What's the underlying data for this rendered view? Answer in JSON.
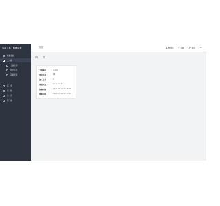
{
  "sidebar": {
    "title": "弓箭工具 · 管理后台",
    "items": [
      {
        "label": "数据看板"
      },
      {
        "label": "土 · 用"
      },
      {
        "label": "土壤检测"
      },
      {
        "label": "用户信息"
      },
      {
        "label": "设备管理"
      },
      {
        "label": "任 · 务"
      },
      {
        "label": "系 · 统"
      },
      {
        "label": "日 · 志"
      },
      {
        "label": "帮 · 助"
      }
    ]
  },
  "topbar": {
    "breadcrumb": "首页",
    "actions": [
      {
        "label": "管理员",
        "icon": "user-icon"
      },
      {
        "label": "切换",
        "icon": "switch-icon"
      },
      {
        "label": "退出",
        "icon": "logout-icon"
      }
    ]
  },
  "detail": {
    "rows": [
      {
        "key": "土地编号",
        "value": "未命名"
      },
      {
        "key": "平台名称",
        "value": "1B"
      },
      {
        "key": "接入方式",
        "value": "0"
      },
      {
        "key": "地址状态",
        "value": "0 / 4 · 7 / 13"
      },
      {
        "key": "创建时间",
        "value": "2021-07-12 17:28:06"
      },
      {
        "key": "更新时间",
        "value": "2021-07-14 11:33:47"
      }
    ]
  },
  "colors": {
    "sidebar": "#2e3440",
    "background": "#f2f3f5",
    "card": "#ffffff"
  }
}
